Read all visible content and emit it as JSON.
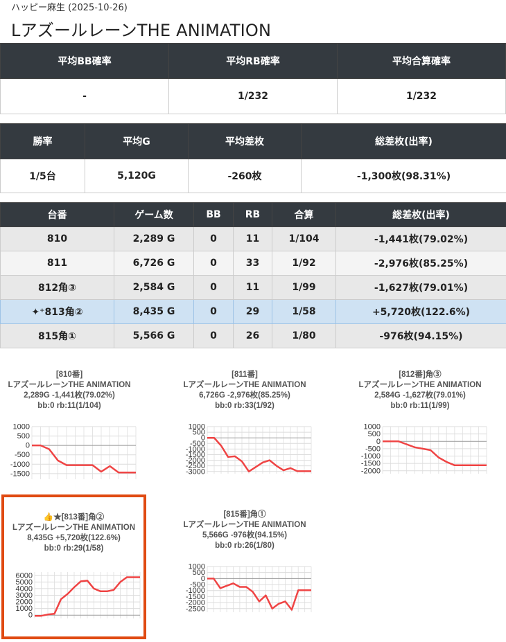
{
  "header": {
    "subtitle": "ハッピー麻生 (2025-10-26)",
    "title": "LアズールレーンTHE ANIMATION"
  },
  "probability_table": {
    "headers": [
      "平均BB確率",
      "平均RB確率",
      "平均合算確率"
    ],
    "values": [
      "-",
      "1/232",
      "1/232"
    ]
  },
  "summary_table": {
    "headers": [
      "勝率",
      "平均G",
      "平均差枚",
      "総差枚(出率)"
    ],
    "values": [
      "1/5台",
      "5,120G",
      "-260枚",
      "-1,300枚(98.31%)"
    ]
  },
  "machine_table": {
    "headers": [
      "台番",
      "ゲーム数",
      "BB",
      "RB",
      "合算",
      "総差枚(出率)"
    ],
    "rows": [
      {
        "num": "810",
        "games": "2,289 G",
        "bb": "0",
        "rb": "11",
        "total": "1/104",
        "diff": "-1,441枚(79.02%)"
      },
      {
        "num": "811",
        "games": "6,726 G",
        "bb": "0",
        "rb": "33",
        "total": "1/92",
        "diff": "-2,976枚(85.25%)"
      },
      {
        "num": "812角③",
        "games": "2,584 G",
        "bb": "0",
        "rb": "11",
        "total": "1/99",
        "diff": "-1,627枚(79.01%)"
      },
      {
        "num": "813角②",
        "games": "8,435 G",
        "bb": "0",
        "rb": "29",
        "total": "1/58",
        "diff": "+5,720枚(122.6%)"
      },
      {
        "num": "815角①",
        "games": "5,566 G",
        "bb": "0",
        "rb": "26",
        "total": "1/80",
        "diff": "-976枚(94.15%)"
      }
    ]
  },
  "highlight_icon": "sparkle-icon",
  "colors": {
    "header_bg": "#343a40",
    "highlight_row": "#cfe2f3",
    "line": "#ef4444",
    "selected_border": "#e04a12"
  },
  "chart_data": [
    {
      "type": "line",
      "title": "[810番]",
      "lines": [
        "[810番]",
        "LアズールレーンTHE ANIMATION",
        "2,289G -1,441枚(79.02%)",
        "bb:0 rb:11(1/104)"
      ],
      "yticks": [
        1000,
        500,
        0,
        -500,
        -1000,
        -1500
      ],
      "ylim": [
        -1800,
        1000
      ],
      "values": [
        0,
        0,
        -200,
        -800,
        -1050,
        -1050,
        -1050,
        -1050,
        -1400,
        -1100,
        -1440,
        -1441,
        -1441
      ]
    },
    {
      "type": "line",
      "title": "[811番]",
      "lines": [
        "[811番]",
        "LアズールレーンTHE ANIMATION",
        "6,726G -2,976枚(85.25%)",
        "bb:0 rb:33(1/92)"
      ],
      "yticks": [
        1000,
        500,
        0,
        -500,
        -1000,
        -1500,
        -2000,
        -2500,
        -3000
      ],
      "ylim": [
        -3200,
        1000
      ],
      "values": [
        0,
        0,
        -700,
        -1700,
        -1650,
        -2100,
        -3000,
        -2600,
        -2200,
        -2000,
        -2500,
        -2900,
        -2700,
        -2976,
        -2976,
        -2976
      ]
    },
    {
      "type": "line",
      "title": "[812番]角③",
      "lines": [
        "[812番]角③",
        "LアズールレーンTHE ANIMATION",
        "2,584G -1,627枚(79.01%)",
        "bb:0 rb:11(1/99)"
      ],
      "yticks": [
        1000,
        500,
        0,
        -500,
        -1000,
        -1500,
        -2000
      ],
      "ylim": [
        -2200,
        1000
      ],
      "values": [
        0,
        0,
        0,
        -200,
        -400,
        -500,
        -600,
        -1100,
        -1400,
        -1627,
        -1627,
        -1627,
        -1627,
        -1627
      ]
    },
    {
      "type": "line",
      "title": "👍★[813番]角②",
      "lines": [
        "👍★[813番]角②",
        "LアズールレーンTHE ANIMATION",
        "8,435G +5,720枚(122.6%)",
        "bb:0 rb:29(1/58)"
      ],
      "yticks": [
        6000,
        5000,
        4000,
        3000,
        2000,
        1000,
        0
      ],
      "ylim": [
        -500,
        6500
      ],
      "values": [
        -100,
        -100,
        100,
        200,
        2400,
        3200,
        4200,
        5100,
        5200,
        4000,
        3600,
        3600,
        3800,
        5000,
        5720,
        5720,
        5720
      ]
    },
    {
      "type": "line",
      "title": "[815番]角①",
      "lines": [
        "[815番]角①",
        "LアズールレーンTHE ANIMATION",
        "5,566G -976枚(94.15%)",
        "bb:0 rb:26(1/80)"
      ],
      "yticks": [
        1000,
        500,
        0,
        -500,
        -1000,
        -1500,
        -2000,
        -2500
      ],
      "ylim": [
        -2800,
        1000
      ],
      "values": [
        0,
        0,
        -800,
        -600,
        -400,
        -700,
        -700,
        -1100,
        -1900,
        -1400,
        -2500,
        -2100,
        -1900,
        -2600,
        -976,
        -976,
        -976
      ]
    }
  ]
}
